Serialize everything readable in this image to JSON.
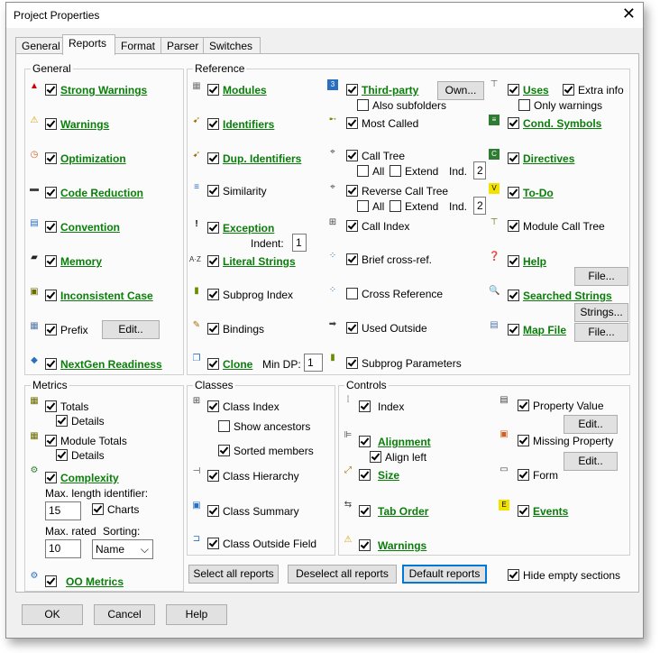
{
  "window": {
    "title": "Project Properties",
    "close_glyph": "✕"
  },
  "tabs": [
    "General",
    "Reports",
    "Format",
    "Parser",
    "Switches"
  ],
  "general": {
    "label": "General",
    "items": [
      "Strong Warnings",
      "Warnings",
      "Optimization",
      "Code Reduction",
      "Convention",
      "Memory",
      "Inconsistent Case",
      "Prefix",
      "NextGen Readiness"
    ],
    "prefix_edit": "Edit.."
  },
  "reference": {
    "label": "Reference",
    "col1": [
      "Modules",
      "Identifiers",
      "Dup. Identifiers",
      "Similarity",
      "Exception",
      "Literal Strings",
      "Subprog Index",
      "Bindings",
      "Clone"
    ],
    "indent_label": "Indent:",
    "indent_value": "1",
    "min_dp_label": "Min DP:",
    "min_dp_value": "1",
    "col2": {
      "third_party": "Third-party",
      "own_button": "Own...",
      "also_subfolders": "Also subfolders",
      "most_called": "Most Called",
      "call_tree": "Call Tree",
      "reverse_call_tree": "Reverse Call Tree",
      "all": "All",
      "extend": "Extend",
      "ind": "Ind.",
      "ind_value": "2",
      "call_index": "Call Index",
      "brief_cross_ref": "Brief cross-ref.",
      "cross_reference": "Cross Reference",
      "used_outside": "Used Outside",
      "subprog_parameters": "Subprog Parameters"
    },
    "col3": {
      "uses": "Uses",
      "extra_info": "Extra info",
      "only_warnings": "Only warnings",
      "cond_symbols": "Cond. Symbols",
      "directives": "Directives",
      "todo": "To-Do",
      "module_call_tree": "Module Call Tree",
      "help": "Help",
      "file_button": "File...",
      "searched_strings": "Searched Strings",
      "strings_button": "Strings...",
      "map_file": "Map File"
    }
  },
  "metrics": {
    "label": "Metrics",
    "totals": "Totals",
    "details": "Details",
    "module_totals": "Module Totals",
    "complexity": "Complexity",
    "max_length_label": "Max. length identifier:",
    "max_length_value": "15",
    "charts": "Charts",
    "max_rated_label": "Max. rated",
    "sorting_label": "Sorting:",
    "max_rated_value": "10",
    "sorting_value": "Name",
    "oo_metrics": "OO Metrics"
  },
  "classes": {
    "label": "Classes",
    "class_index": "Class Index",
    "show_ancestors": "Show ancestors",
    "sorted_members": "Sorted members",
    "class_hierarchy": "Class Hierarchy",
    "class_summary": "Class Summary",
    "class_outside_field": "Class Outside Field"
  },
  "controls": {
    "label": "Controls",
    "index": "Index",
    "alignment": "Alignment",
    "align_left": "Align left",
    "size": "Size",
    "tab_order": "Tab Order",
    "warnings": "Warnings",
    "property_value": "Property Value",
    "missing_property": "Missing Property",
    "form": "Form",
    "events": "Events",
    "edit": "Edit.."
  },
  "buttons": {
    "select_all": "Select all reports",
    "deselect_all": "Deselect all reports",
    "default": "Default reports",
    "hide_empty": "Hide empty sections",
    "ok": "OK",
    "cancel": "Cancel",
    "help": "Help"
  }
}
